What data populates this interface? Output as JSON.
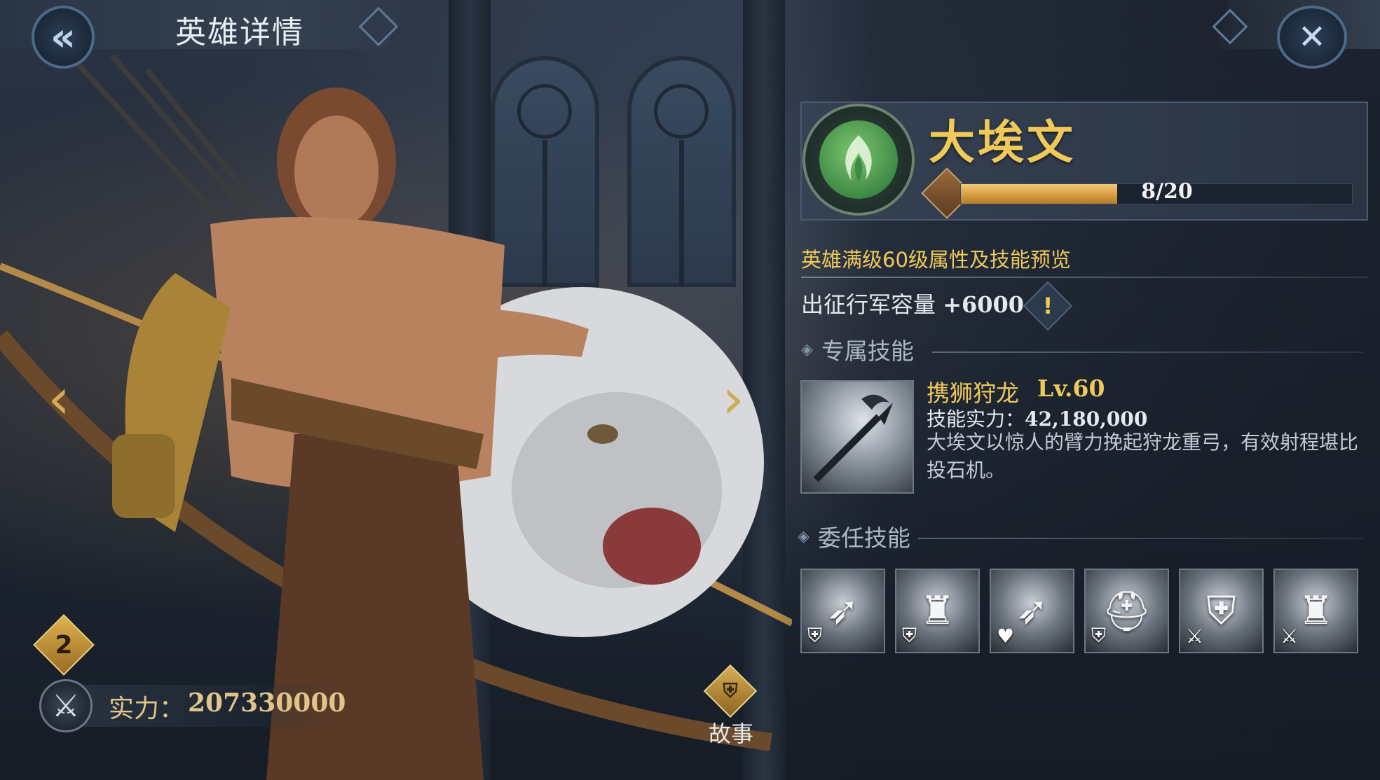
{
  "header": {
    "title": "英雄详情",
    "back_icon": "double-chevron-left-icon",
    "close_icon": "crossed-swords-close-icon"
  },
  "hero": {
    "name": "大埃文",
    "shards_current": 8,
    "shards_required": 20,
    "shards_text": "8/20",
    "progress_fraction": 0.4,
    "faction_icon": "green-flame-emblem-icon"
  },
  "preview_text": "英雄满级60级属性及技能预览",
  "march": {
    "label": "出征行军容量",
    "value": "+6000",
    "info_glyph": "!"
  },
  "exclusive_skill": {
    "section_title": "专属技能",
    "name": "携狮狩龙",
    "level": "Lv.60",
    "power_label": "技能实力：",
    "power_value": "42,180,000",
    "description": "大埃文以惊人的臂力挽起狩龙重弓，有效射程堪比投石机。"
  },
  "assignment_skills": {
    "section_title": "委任技能",
    "slots": [
      {
        "icon": "crossbow-shield-icon",
        "glyph": "➶",
        "badge": "⛨"
      },
      {
        "icon": "soldier-shield-icon",
        "glyph": "♜",
        "badge": "⛨"
      },
      {
        "icon": "crossbow-heart-icon",
        "glyph": "➶",
        "badge": "♥"
      },
      {
        "icon": "helmet-shield-icon",
        "glyph": "⛑",
        "badge": "⛨"
      },
      {
        "icon": "shield-swords-icon",
        "glyph": "⛨",
        "badge": "⚔"
      },
      {
        "icon": "soldier-swords-icon",
        "glyph": "♜",
        "badge": "⚔"
      }
    ]
  },
  "bottom": {
    "rank_value": "2",
    "power_label": "实力：",
    "power_value": "207330000",
    "story_label": "故事",
    "story_icon": "helmet-scroll-icon"
  },
  "nav": {
    "prev_glyph": "‹",
    "next_glyph": "›"
  },
  "colors": {
    "accent_gold": "#f0c95a",
    "progress_fill": "#d49a3e",
    "faction_green": "#3f8a46",
    "panel_bg": "#2c3747"
  }
}
